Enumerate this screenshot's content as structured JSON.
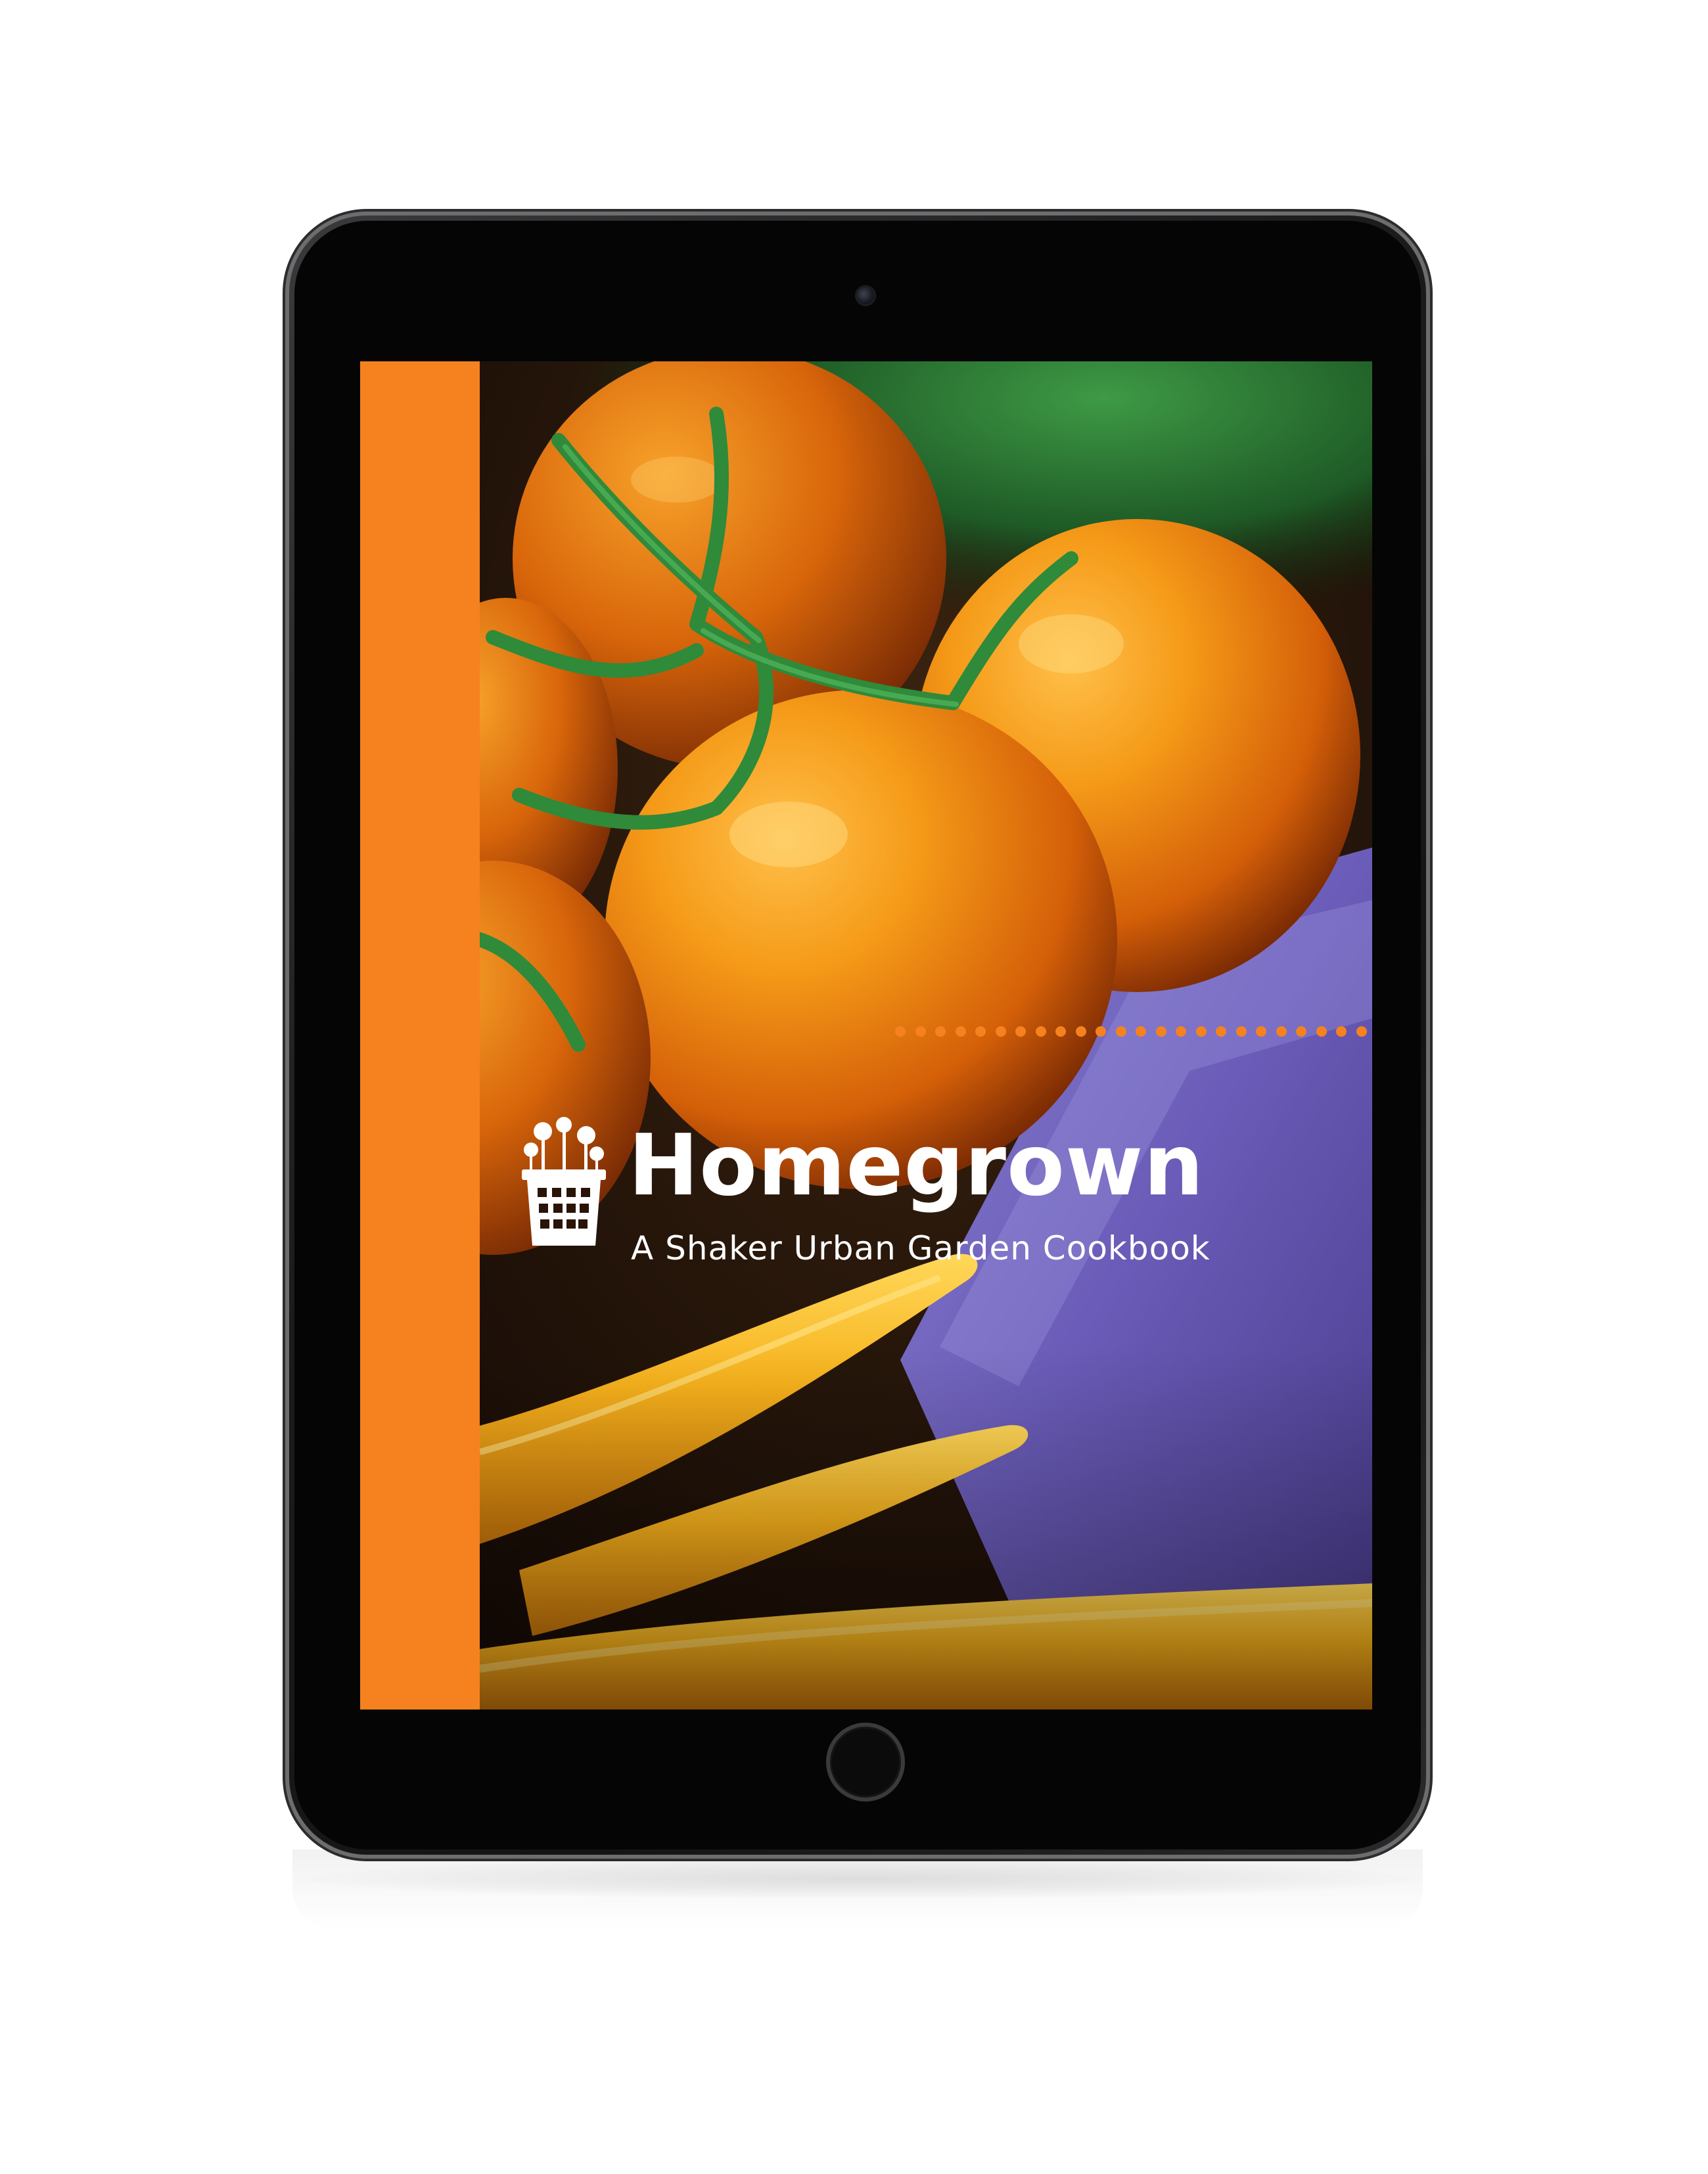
{
  "cover": {
    "title": "Homegrown",
    "subtitle": "A Shaker Urban Garden Cookbook",
    "accent_color": "#f5821f",
    "dot_count": 24
  },
  "device": {
    "body_color": "#1b1b1c",
    "bezel_color": "#050505"
  },
  "photo": {
    "background_color": "#2a1408",
    "tomato_color": "#e8700e",
    "leaf_color": "#2f8a3a",
    "carrot_color": "#f5a518",
    "table_color": "#6b5fb0"
  }
}
